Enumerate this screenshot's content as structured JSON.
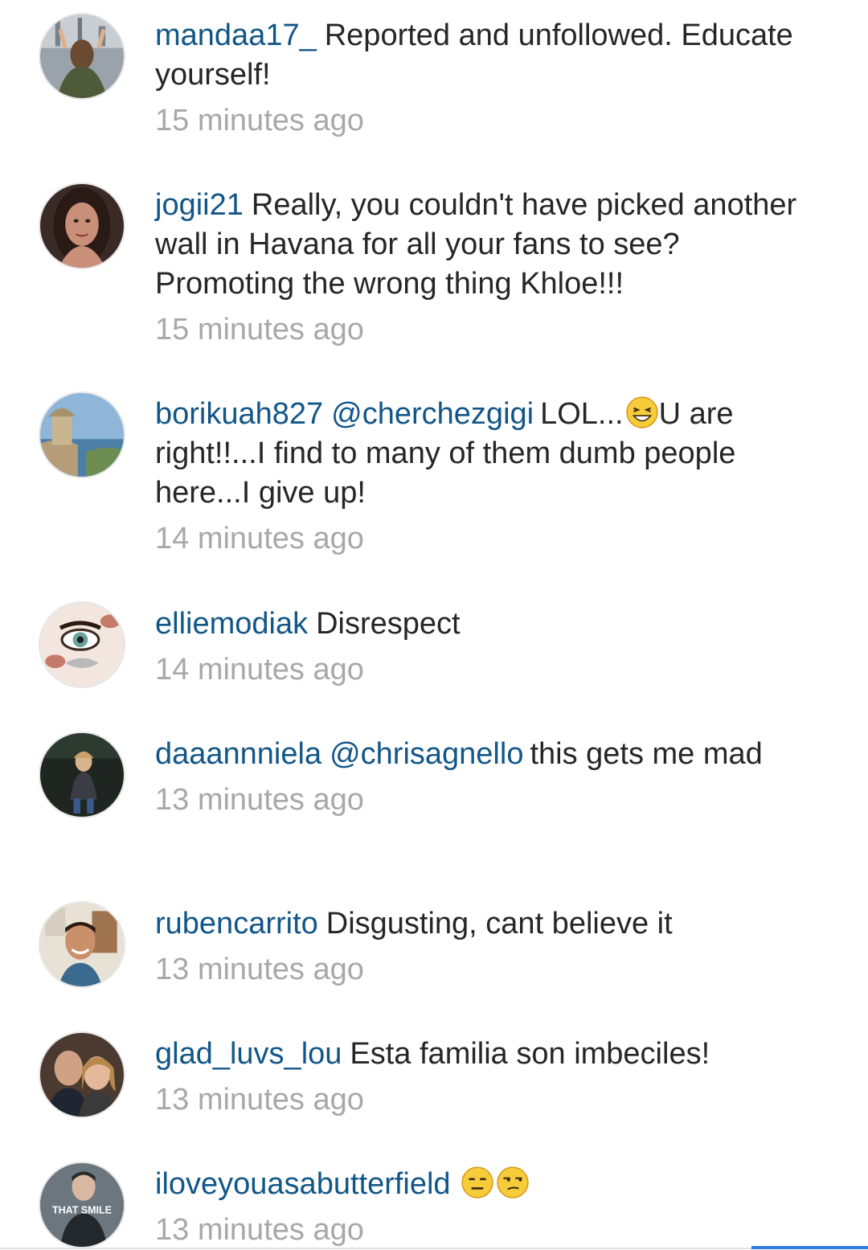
{
  "comments": [
    {
      "username": "mandaa17_",
      "mention": "",
      "text": "Reported and unfollowed. Educate yourself!",
      "emoji": [],
      "time": "15 minutes ago",
      "avatar_icon": "user-avatar-photo"
    },
    {
      "username": "jogii21",
      "mention": "",
      "text": "Really, you couldn't have picked another wall in Havana for all your fans to see? Promoting the wrong thing Khloe!!!",
      "emoji": [],
      "time": "15 minutes ago",
      "avatar_icon": "user-avatar-photo"
    },
    {
      "username": "borikuah827",
      "mention": "@cherchezgigi",
      "text_before_emoji": "LOL...",
      "emoji": [
        "grinning-squinting-face-emoji"
      ],
      "text": "U are right!!...I find to many of them dumb people here...I give up!",
      "time": "14 minutes ago",
      "avatar_icon": "user-avatar-photo"
    },
    {
      "username": "elliemodiak",
      "mention": "",
      "text": "Disrespect",
      "emoji": [],
      "time": "14 minutes ago",
      "avatar_icon": "user-avatar-photo"
    },
    {
      "username": "daaannniela",
      "mention": "@chrisagnello",
      "text": "this gets me mad",
      "emoji": [],
      "time": "13 minutes ago",
      "avatar_icon": "user-avatar-photo"
    },
    {
      "username": "rubencarrito",
      "mention": "",
      "text": "Disgusting, cant believe it",
      "emoji": [],
      "time": "13 minutes ago",
      "avatar_icon": "user-avatar-photo"
    },
    {
      "username": "glad_luvs_lou",
      "mention": "",
      "text": "Esta familia son imbeciles!",
      "emoji": [],
      "time": "13 minutes ago",
      "avatar_icon": "user-avatar-photo"
    },
    {
      "username": "iloveyouasabutterfield",
      "mention": "",
      "text": "",
      "emoji": [
        "expressionless-face-emoji",
        "unamused-face-emoji"
      ],
      "time": "13 minutes ago",
      "avatar_icon": "user-avatar-photo",
      "avatar_caption": "THAT SMILE"
    }
  ],
  "colors": {
    "username": "#125688",
    "text": "#262626",
    "timestamp": "#a8a8a8",
    "background": "#ffffff"
  }
}
